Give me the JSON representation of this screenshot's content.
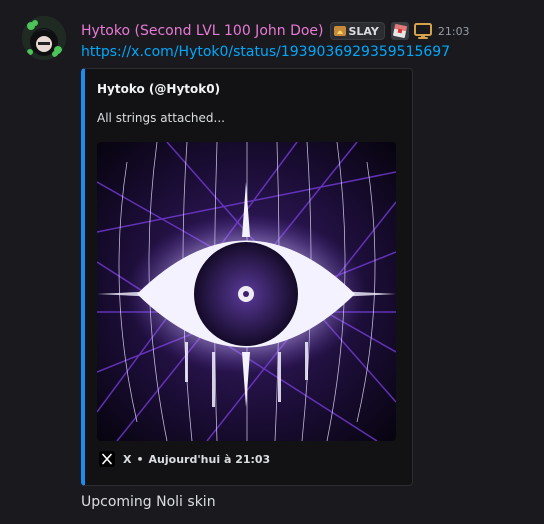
{
  "message": {
    "author": "Hytoko (Second LVL 100 John Doe)",
    "tag": "SLAY",
    "time": "21:03",
    "link": "https://x.com/Hytok0/status/1939036929359515697",
    "content": "Upcoming Noli skin",
    "colors": {
      "username": "#e879d6",
      "link": "#00a8fc",
      "embed_border": "#1e8bf0"
    }
  },
  "embed": {
    "author": "Hytoko (@Hytok0)",
    "description": "All strings attached...",
    "footer": {
      "source": "X",
      "separator": "•",
      "timestamp": "Aujourd'hui à 21:03"
    }
  },
  "icons": {
    "tag_icon": "flame-icon",
    "role_icon": "roblox-icon",
    "platform_icon": "monitor-icon",
    "footer_icon": "x-logo-icon"
  }
}
